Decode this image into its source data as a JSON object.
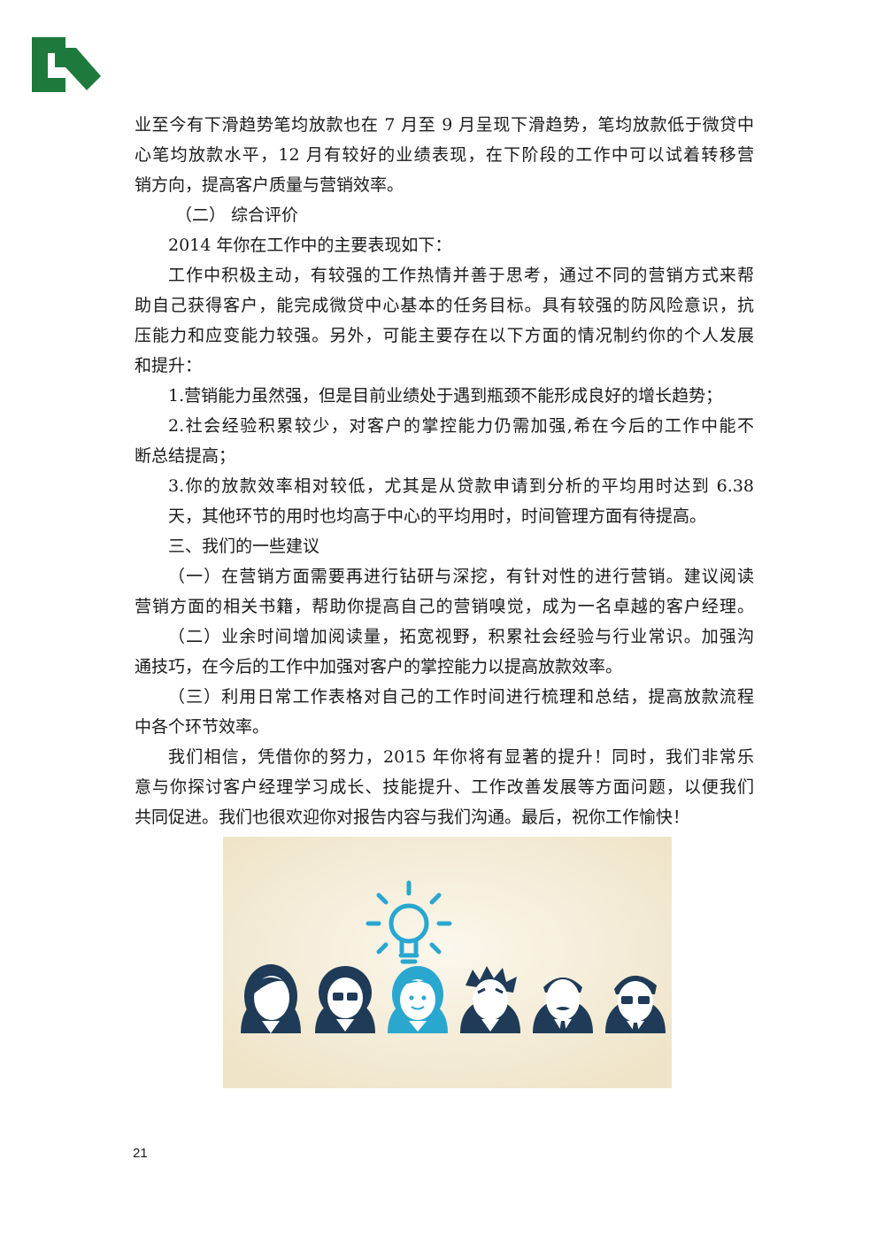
{
  "brand": {
    "logo_icon": "logo-mark-icon",
    "logo_color": "#1e7a3c"
  },
  "paragraphs": {
    "p1": [
      "业至今有下滑趋势笔均放款也在 7 月至 9 月呈现下滑趋势，笔均放款低于微贷中",
      "心笔均放款水平，12 月有较好的业绩表现，在下阶段的工作中可以试着转移营",
      "销方向，提高客户质量与营销效率。"
    ],
    "h_comprehensive": "（二） 综合评价",
    "intro": "2014 年你在工作中的主要表现如下：",
    "p2": [
      "工作中积极主动，有较强的工作热情并善于思考，通过不同的营销方式来帮",
      "助自己获得客户，能完成微贷中心基本的任务目标。具有较强的防风险意识，抗",
      "压能力和应变能力较强。另外，可能主要存在以下方面的情况制约你的个人发展",
      "和提升："
    ],
    "item1": "1.营销能力虽然强，但是目前业绩处于遇到瓶颈不能形成良好的增长趋势；",
    "item2": [
      "2.社会经验积累较少，对客户的掌控能力仍需加强,希在今后的工作中能不",
      "断总结提高；"
    ],
    "item3": [
      "3.你的放款效率相对较低，尤其是从贷款申请到分析的平均用时达到 6.38",
      "天，其他环节的用时也均高于中心的平均用时，时间管理方面有待提高。"
    ],
    "h_suggestions": "三、我们的一些建议",
    "s1": [
      "（一）在营销方面需要再进行钻研与深挖，有针对性的进行营销。建议阅读",
      "营销方面的相关书籍，帮助你提高自己的营销嗅觉，成为一名卓越的客户经理。"
    ],
    "s2": [
      "（二）业余时间增加阅读量，拓宽视野，积累社会经验与行业常识。加强沟",
      "通技巧，在今后的工作中加强对客户的掌控能力以提高放款效率。"
    ],
    "s3": [
      "（三）利用日常工作表格对自己的工作时间进行梳理和总结，提高放款流程",
      "中各个环节效率。"
    ],
    "closing": [
      "我们相信，凭借你的努力，2015 年你将有显著的提升！同时，我们非常乐",
      "意与你探讨客户经理学习成长、技能提升、工作改善发展等方面问题，以便我们",
      "共同促进。我们也很欢迎你对报告内容与我们沟通。最后，祝你工作愉快！"
    ]
  },
  "illustration": {
    "background": "#f3ecd8",
    "figure_color": "#1f3b57",
    "highlight_color": "#2aa7cf",
    "icon": "lightbulb-icon"
  },
  "page_number": "21"
}
